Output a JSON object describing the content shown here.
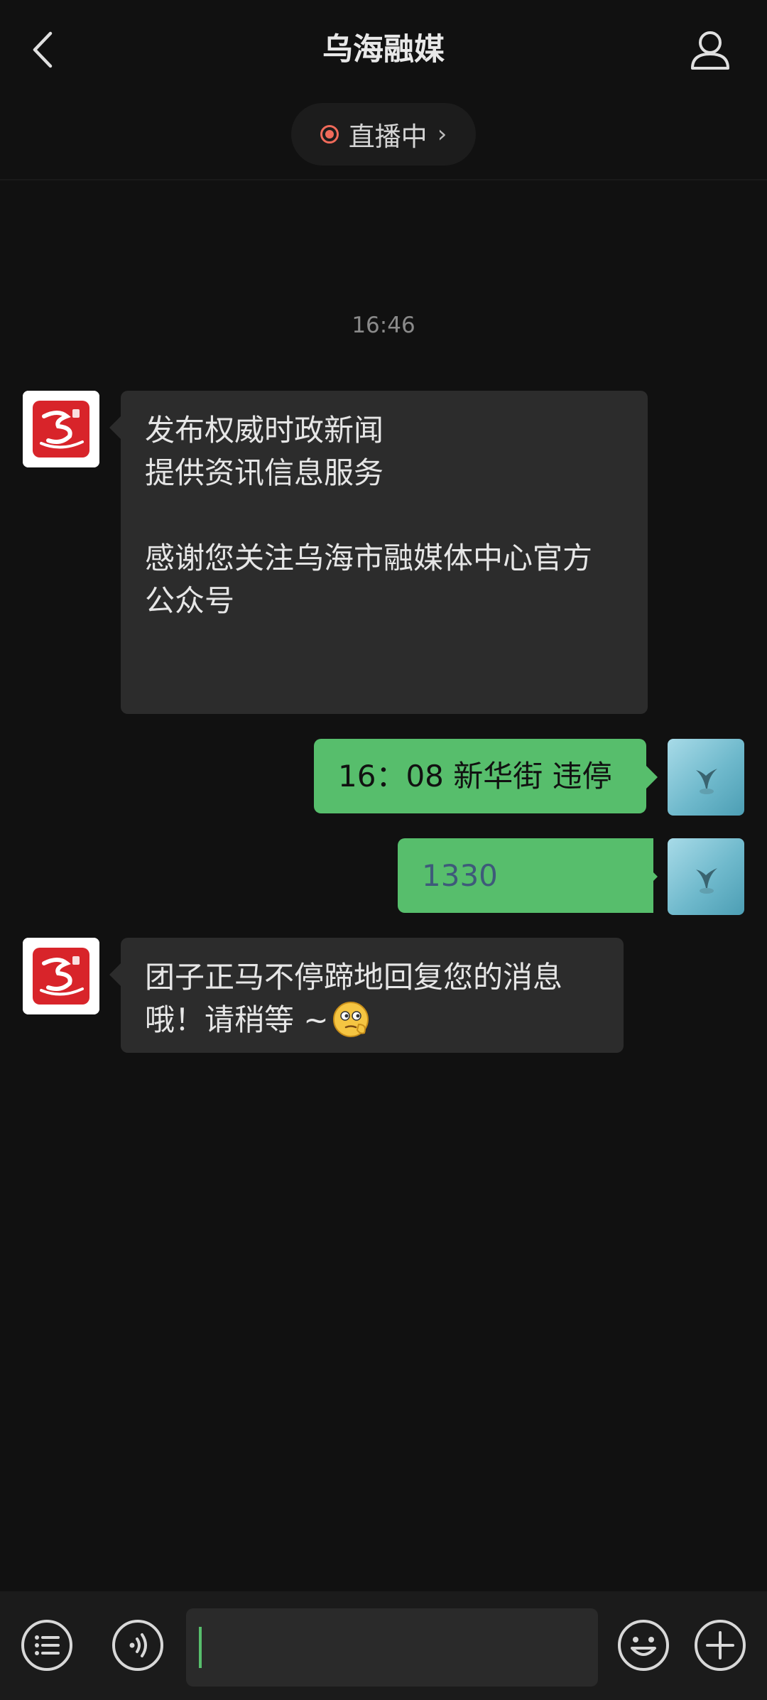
{
  "header": {
    "title": "乌海融媒",
    "live_label": "直播中",
    "live_chevron": "›"
  },
  "chat": {
    "timestamp": "16:46",
    "messages": [
      {
        "direction": "in",
        "lines": [
          "发布权威时政新闻",
          "提供资讯信息服务",
          "",
          "感谢您关注乌海市融媒体中心官方",
          "公众号"
        ]
      },
      {
        "direction": "out",
        "text": "16：08 新华街 违停"
      },
      {
        "direction": "out",
        "text": "1330",
        "note": "remaining digits blurred"
      },
      {
        "direction": "in",
        "lines": [
          "团子正马不停蹄地回复您的消息",
          "哦！请稍等 ~"
        ]
      }
    ]
  },
  "icons": {
    "back": "back-arrow-icon",
    "profile": "person-icon",
    "menu": "menu-list-icon",
    "voice": "voice-icon",
    "emoji": "emoji-icon",
    "plus": "plus-icon"
  },
  "colors": {
    "background": "#111111",
    "incoming_bubble": "#2c2c2c",
    "outgoing_bubble": "#57be6c",
    "live_dot": "#f06a5a",
    "logo_red": "#d8242a"
  }
}
